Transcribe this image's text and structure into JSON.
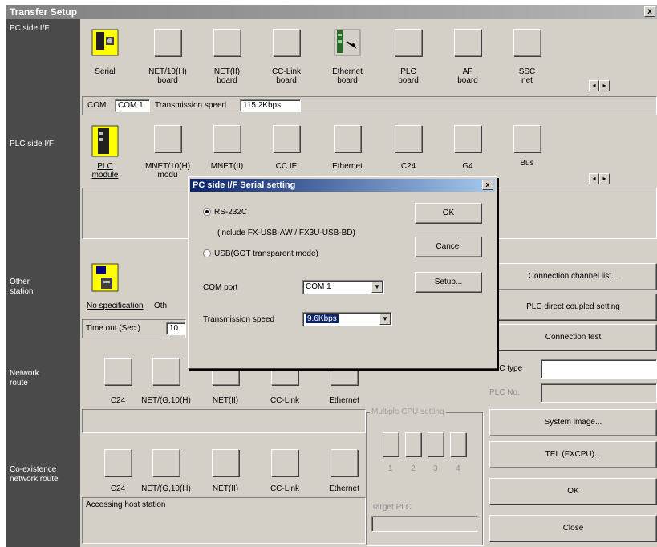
{
  "window": {
    "title": "Transfer Setup",
    "close": "x"
  },
  "pc_side": {
    "label": "PC side I/F",
    "items": [
      "Serial",
      "NET/10(H)\nboard",
      "NET(II)\nboard",
      "CC-Link\nboard",
      "Ethernet\nboard",
      "PLC\nboard",
      "AF\nboard",
      "SSC\nnet"
    ],
    "com_label": "COM",
    "com_value": "COM 1",
    "speed_label": "Transmission speed",
    "speed_value": "115.2Kbps"
  },
  "plc_side": {
    "label": "PLC side I/F",
    "items": [
      "PLC\nmodule",
      "MNET/10(H)\nmodu",
      "MNET(II)",
      "CC IE",
      "Ethernet",
      "C24",
      "G4",
      "Bus"
    ]
  },
  "other_station": {
    "label": "Other\nstation",
    "no_spec": "No specification",
    "oth": "Oth",
    "timeout_label": "Time out (Sec.)",
    "timeout_value": "10"
  },
  "network_route": {
    "label": "Network\nroute",
    "items": [
      "C24",
      "NET/(G,10(H)",
      "NET(II)",
      "CC-Link",
      "Ethernet"
    ]
  },
  "coexistence": {
    "label": "Co-existence\nnetwork route",
    "items": [
      "C24",
      "NET/(G,10(H)",
      "NET(II)",
      "CC-Link",
      "Ethernet"
    ],
    "accessing": "Accessing host station"
  },
  "multiple_cpu": {
    "title": "Multiple CPU setting",
    "numbers": [
      "1",
      "2",
      "3",
      "4"
    ],
    "target": "Target PLC"
  },
  "right_buttons": {
    "connection_channel": "Connection channel list...",
    "plc_direct": "PLC direct coupled setting",
    "connection_test": "Connection test",
    "plc_type": "PLC type",
    "plc_no": "PLC No.",
    "system_image": "System image...",
    "tel": "TEL (FXCPU)...",
    "ok": "OK",
    "close": "Close"
  },
  "dialog": {
    "title": "PC side I/F Serial setting",
    "rs232c": "RS-232C",
    "include": "(include FX-USB-AW / FX3U-USB-BD)",
    "usb": "USB(GOT transparent mode)",
    "com_port_label": "COM port",
    "com_port_value": "COM 1",
    "speed_label": "Transmission speed",
    "speed_value": "9.6Kbps",
    "ok": "OK",
    "cancel": "Cancel",
    "setup": "Setup..."
  }
}
